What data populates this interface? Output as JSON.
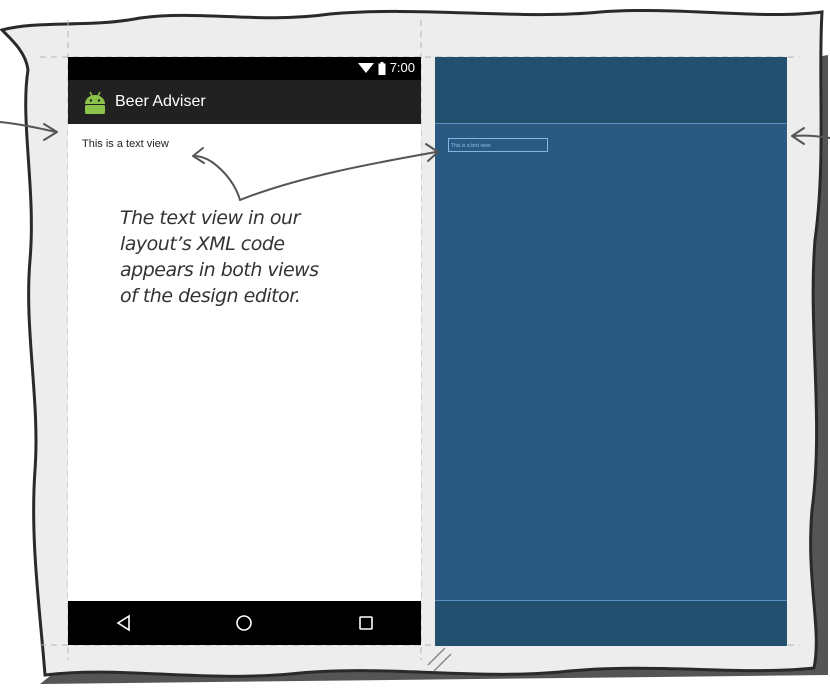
{
  "phone": {
    "status_time": "7:00",
    "app_title": "Beer Adviser",
    "text_view": "This is a text view",
    "icons": {
      "wifi": "wifi-icon",
      "battery": "battery-icon",
      "app": "android-icon",
      "back": "back-triangle-icon",
      "home": "home-circle-icon",
      "recents": "recents-square-icon"
    }
  },
  "blueprint": {
    "text_view": "This is a text view"
  },
  "annotation": {
    "lines": [
      "The text view in our",
      "layout’s XML code",
      "appears in both views",
      "of the design editor."
    ]
  },
  "colors": {
    "blueprint": "#2a5a82",
    "blueprint_bars": "#24506f",
    "android_green": "#8bc34a",
    "app_bar": "#212121"
  }
}
